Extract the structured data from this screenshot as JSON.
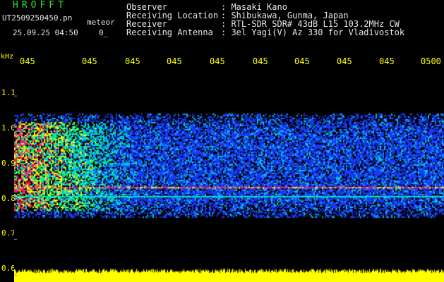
{
  "header": {
    "app_title": "HROFFT",
    "file_name": "UT2509250450.pn",
    "file_type": "meteor",
    "date_time": "25.09.25 04:50",
    "count": "0_",
    "info": [
      {
        "key": "Observer",
        "value": ": Masaki Kano"
      },
      {
        "key": "Receiving Location",
        "value": ": Shibukawa, Gunma, Japan"
      },
      {
        "key": "Receiver",
        "value": ": RTL-SDR SDR# 43dB L15 103.2MHz CW"
      },
      {
        "key": "Receiving Antenna",
        "value": ": 3el Yagi(V) Az 330 for Vladivostok"
      }
    ]
  },
  "chart_data": {
    "type": "heatmap",
    "ylabel": "kHz",
    "x_ticks": [
      "045",
      "045",
      "045",
      "045",
      "045",
      "045",
      "045",
      "045",
      "045",
      "0500"
    ],
    "y_ticks": [
      "1.1",
      "1.0",
      "0.9",
      "0.8",
      "0.7",
      "0.6"
    ],
    "ylim": [
      0.58,
      1.18
    ],
    "noise_band": [
      0.76,
      1.05
    ],
    "signal_lines": [
      0.845,
      0.82
    ],
    "strong_region": {
      "x_fraction": [
        0,
        0.2
      ],
      "freq": [
        0.78,
        1.03
      ]
    },
    "colors": {
      "background": "#000000",
      "low": "#1a3cff",
      "mid": "#00c8ff",
      "high": "#ffff00",
      "peak": "#ff1a78",
      "text": "#ffff00"
    }
  }
}
